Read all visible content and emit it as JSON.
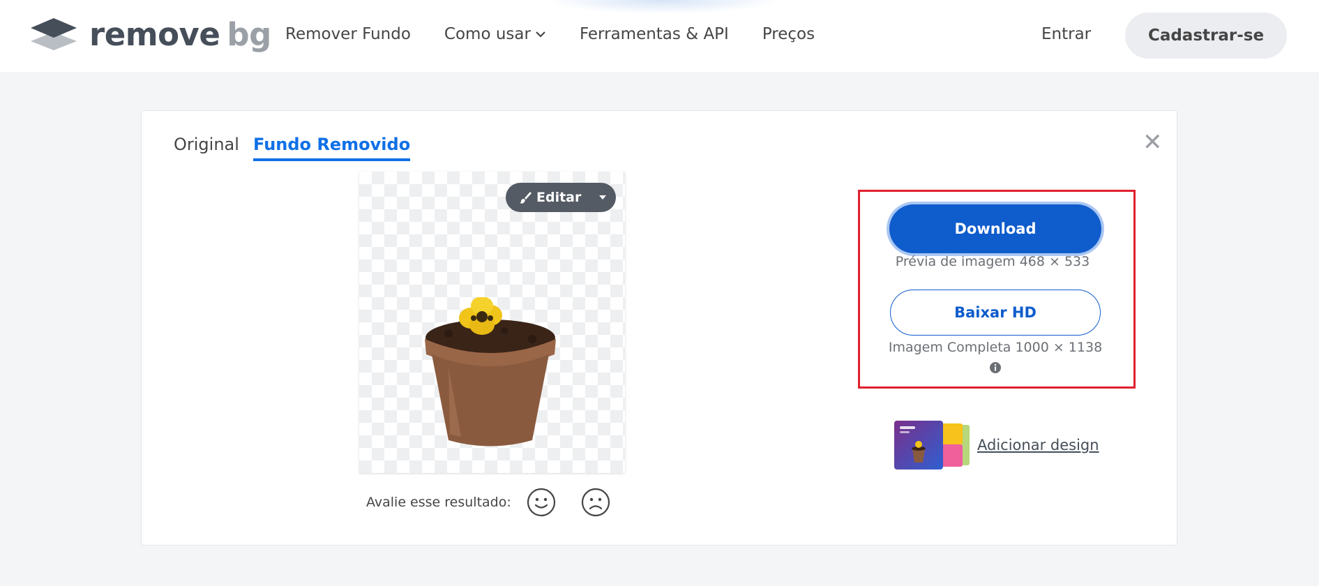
{
  "brand": {
    "logo_word_1": "remove",
    "logo_word_2": "bg"
  },
  "nav": {
    "items": [
      {
        "label": "Remover Fundo"
      },
      {
        "label": "Como usar"
      },
      {
        "label": "Ferramentas & API"
      },
      {
        "label": "Preços"
      }
    ],
    "login_label": "Entrar",
    "signup_label": "Cadastrar-se"
  },
  "editor": {
    "tabs": [
      {
        "label": "Original",
        "active": false
      },
      {
        "label": "Fundo Removido",
        "active": true
      }
    ],
    "close_glyph": "✕",
    "edit_label": "Editar",
    "rate_label": "Avalie esse resultado:"
  },
  "download": {
    "download_label": "Download",
    "preview_note": "Prévia de imagem 468 × 533",
    "hd_label": "Baixar HD",
    "hd_note": "Imagem Completa 1000 × 1138",
    "add_design_label": "Adicionar design"
  },
  "colors": {
    "accent": "#0f5ccc",
    "tab_active": "#0f70e6",
    "highlight_box": "#e0202c",
    "edit_button": "#545b64"
  },
  "icons": [
    "logo-layers-icon",
    "chevron-down-icon",
    "close-icon",
    "paintbrush-icon",
    "caret-down-icon",
    "smiley-face-icon",
    "sad-face-icon",
    "info-icon"
  ]
}
